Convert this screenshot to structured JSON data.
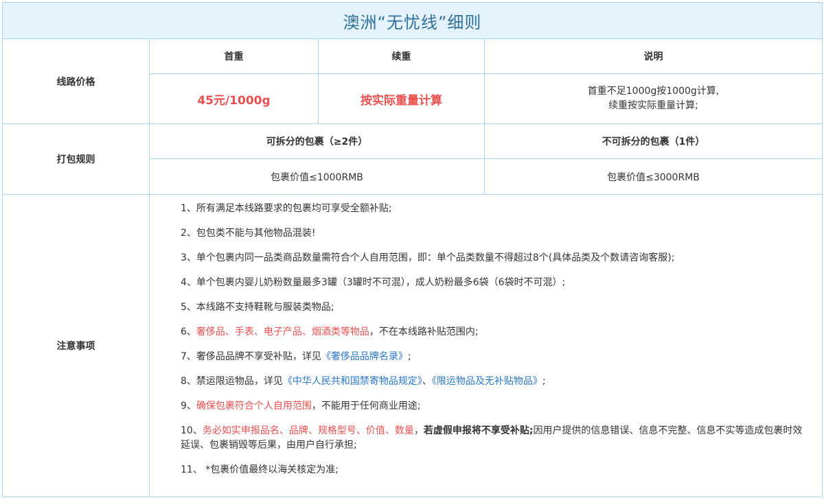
{
  "title": "澳洲“无忧线”细则",
  "pricing": {
    "label": "线路价格",
    "col_first": "首重",
    "col_cont": "续重",
    "col_desc": "说明",
    "first_value": "45元/1000g",
    "cont_value": "按实际重量计算",
    "desc_line1": "首重不足1000g按1000g计算,",
    "desc_line2": "续重按实际重量计算;"
  },
  "packing": {
    "label": "打包规则",
    "splittable_header": "可拆分的包裹（≥2件）",
    "unsplittable_header": "不可拆分的包裹（1件）",
    "splittable_value": "包裹价值≤1000RMB",
    "unsplittable_value": "包裹价值≤3000RMB"
  },
  "notes": {
    "label": "注意事项",
    "n1": "1、所有满足本线路要求的包裹均可享受全额补贴;",
    "n2": "2、包包类不能与其他物品混装!",
    "n3": "3、单个包裹内同一品类商品数量需符合个人自用范围，即：单个品类数量不得超过8个(具体品类及个数请咨询客服);",
    "n4": "4、单个包裹内婴儿奶粉数量最多3罐（3罐时不可混），成人奶粉最多6袋（6袋时不可混）;",
    "n5": "5、本线路不支持鞋靴与服装类物品;",
    "n6_prefix": "6、",
    "n6_red": "奢侈品、手表、电子产品、烟酒类等物品",
    "n6_suffix": "，不在本线路补贴范围内;",
    "n7_prefix": "7、奢侈品品牌不享受补贴，详见",
    "n7_link": "《奢侈品品牌名录》",
    "n7_suffix": ";",
    "n8_prefix": "8、禁运限运物品，详见",
    "n8_link1": "《中华人民共和国禁寄物品规定》",
    "n8_sep": "、",
    "n8_link2": "《限运物品及无补贴物品》",
    "n8_suffix": ";",
    "n9_prefix": "9、",
    "n9_red": "确保包裹符合个人自用范围",
    "n9_suffix": "，不能用于任何商业用途;",
    "n10_prefix": "10、",
    "n10_red": "务必如实申报品名、品牌、规格型号、价值、数量",
    "n10_sep": "，",
    "n10_bold": "若虚假申报将不享受补贴;",
    "n10_rest": "因用户提供的信息错误、信息不完整、信息不实等造成包裹时效延误、包裹销毁等后果，由用户自行承担;",
    "n11": "11、 *包裹价值最终以海关核定为准;"
  },
  "colors": {
    "border": "#a9d6ea",
    "title_bg": "#e3f2fb",
    "title_text": "#2f6f9a",
    "highlight_red": "#e85050",
    "link_blue": "#2a77c9"
  }
}
